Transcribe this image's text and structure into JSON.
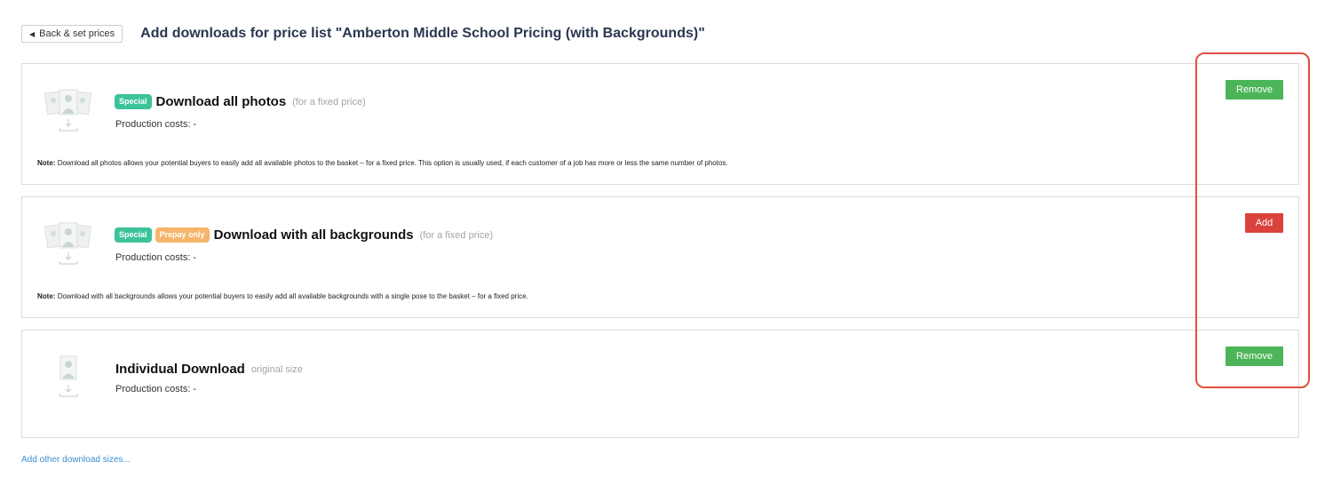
{
  "header": {
    "back_label": "Back & set prices",
    "title": "Add downloads for price list \"Amberton Middle School Pricing (with Backgrounds)\""
  },
  "items": [
    {
      "badges": [
        "Special"
      ],
      "title": "Download all photos",
      "subtitle": "(for a fixed price)",
      "costs": "Production costs: -",
      "note_label": "Note:",
      "note": "Download all photos allows your potential buyers to easily add all available photos to the basket – for a fixed price. This option is usually used, if each customer of a job has more or less the same number of photos.",
      "action": "Remove",
      "icon": "photo-stack-download-icon"
    },
    {
      "badges": [
        "Special",
        "Prepay only"
      ],
      "title": "Download with all backgrounds",
      "subtitle": "(for a fixed price)",
      "costs": "Production costs: -",
      "note_label": "Note:",
      "note": "Download with all backgrounds allows your potential buyers to easily add all available backgrounds with a single pose to the basket – for a fixed price.",
      "action": "Add",
      "icon": "photo-stack-download-icon"
    },
    {
      "badges": [],
      "title": "Individual Download",
      "subtitle": "original size",
      "costs": "Production costs: -",
      "action": "Remove",
      "icon": "single-photo-download-icon"
    }
  ],
  "footer": {
    "add_other_label": "Add other download sizes..."
  },
  "colors": {
    "special_badge": "#3cc39a",
    "prepay_badge": "#f5b56a",
    "remove_button": "#4db559",
    "add_button": "#d9433c",
    "highlight": "#e0503f",
    "link": "#3a8fd0"
  }
}
